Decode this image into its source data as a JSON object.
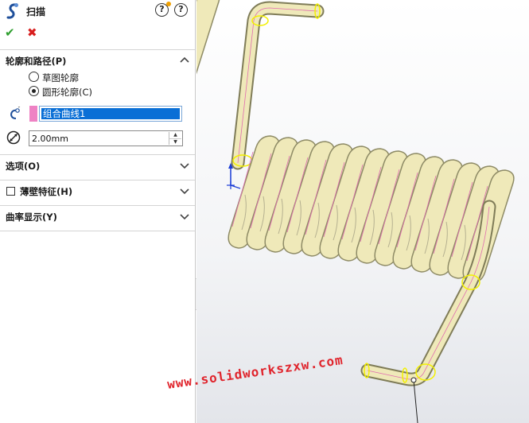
{
  "feature": {
    "title": "扫描",
    "help_symbol": "?"
  },
  "profile_path": {
    "title": "轮廓和路径(P)",
    "options": [
      {
        "label": "草图轮廓",
        "selected": false
      },
      {
        "label": "圆形轮廓(C)",
        "selected": true
      }
    ],
    "path_value": "组合曲线1",
    "diameter_value": "2.00mm"
  },
  "groups": [
    {
      "label": "选项(O)"
    },
    {
      "label": "薄壁特征(H)"
    },
    {
      "label": "曲率显示(Y)"
    }
  ],
  "watermark": "www.solidworkszxw.com",
  "colors": {
    "selection_blue": "#0a6fd6",
    "swatch_pink": "#ee82c4",
    "ok_green": "#2e9e2e",
    "cancel_red": "#d81e1e",
    "model_yellow": "#efe9b9",
    "highlight_yellow": "#f3f000",
    "watermark_red": "#e0242c"
  }
}
